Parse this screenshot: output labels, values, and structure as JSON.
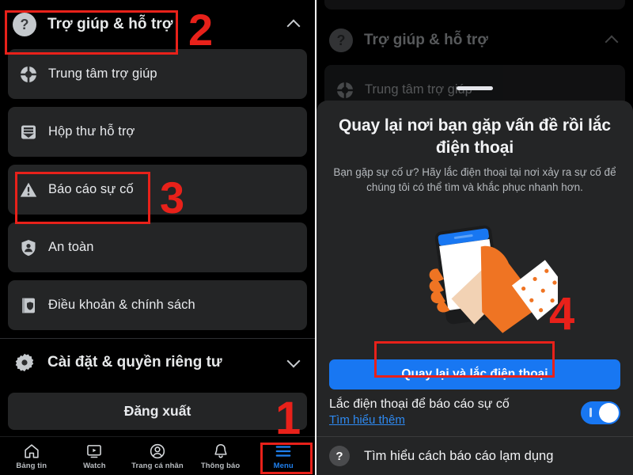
{
  "left_screen": {
    "help_section": {
      "title": "Trợ giúp & hỗ trợ",
      "icon": "question-circle-icon",
      "chevron": "chevron-up-icon",
      "items": [
        {
          "label": "Trung tâm trợ giúp",
          "icon": "lifebuoy-icon"
        },
        {
          "label": "Hộp thư hỗ trợ",
          "icon": "inbox-icon"
        },
        {
          "label": "Báo cáo sự cố",
          "icon": "warning-triangle-icon"
        },
        {
          "label": "An toàn",
          "icon": "shield-person-icon"
        },
        {
          "label": "Điều khoản & chính sách",
          "icon": "book-shield-icon"
        }
      ]
    },
    "settings_section": {
      "title": "Cài đặt & quyền riêng tư",
      "icon": "gear-icon",
      "chevron": "chevron-down-icon"
    },
    "logout_label": "Đăng xuất",
    "bottom_nav": [
      {
        "label": "Bảng tin",
        "icon": "home-icon",
        "active": false
      },
      {
        "label": "Watch",
        "icon": "video-icon",
        "active": false
      },
      {
        "label": "Trang cá nhân",
        "icon": "person-circle-icon",
        "active": false
      },
      {
        "label": "Thông báo",
        "icon": "bell-icon",
        "active": false
      },
      {
        "label": "Menu",
        "icon": "hamburger-icon",
        "active": true
      }
    ]
  },
  "right_screen": {
    "background": {
      "help_title": "Trợ giúp & hỗ trợ",
      "help_icon": "question-circle-icon",
      "chevron": "chevron-up-icon",
      "first_item": "Trung tâm trợ giúp",
      "first_item_icon": "lifebuoy-icon"
    },
    "sheet": {
      "title": "Quay lại nơi bạn gặp vấn đề rồi lắc điện thoại",
      "subtitle": "Bạn gặp sự cố ư? Hãy lắc điện thoại tại nơi xảy ra sự cố để chúng tôi có thể tìm và khắc phục nhanh hơn.",
      "illustration": "hand-shaking-phone-illustration",
      "cta_label": "Quay lại và lắc điện thoại",
      "toggle_title": "Lắc điện thoại để báo cáo sự cố",
      "toggle_link": "Tìm hiểu thêm",
      "toggle_state": "on",
      "help_row_label": "Tìm hiểu cách báo cáo lạm dụng",
      "help_row_icon": "question-circle-icon"
    }
  },
  "annotations": [
    {
      "number": "1",
      "target": "menu-tab"
    },
    {
      "number": "2",
      "target": "help-and-support-header"
    },
    {
      "number": "3",
      "target": "report-problem-row"
    },
    {
      "number": "4",
      "target": "shake-phone-cta"
    }
  ],
  "colors": {
    "accent_blue": "#1877f2",
    "link_blue": "#2e89f0",
    "annotation_red": "#e8211a",
    "card_bg": "#242526",
    "screen_bg": "#000000"
  }
}
